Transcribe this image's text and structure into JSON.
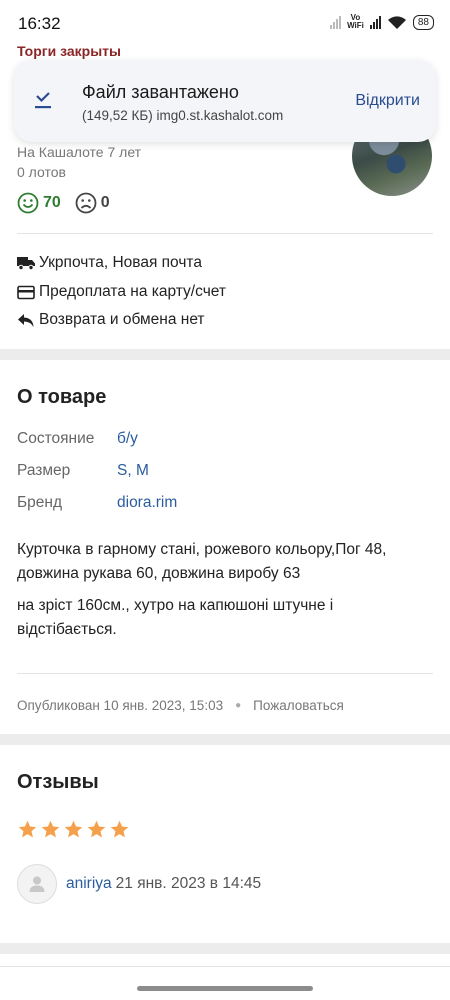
{
  "status_bar": {
    "time": "16:32",
    "network_label_top": "Vo",
    "network_label_bottom": "WiFi",
    "battery": "88"
  },
  "auction_status": "Торги закрыты",
  "download_toast": {
    "title": "Файл завантажено",
    "details": "(149,52 КБ) img0.st.kashalot.com",
    "open_label": "Відкрити"
  },
  "seller": {
    "member_since": "На Кашалоте 7 лет",
    "lots": "0 лотов",
    "positive_count": "70",
    "negative_count": "0"
  },
  "delivery": {
    "shipping": "Укрпочта, Новая почта",
    "payment": "Предоплата на карту/счет",
    "returns": "Возврата и обмена нет"
  },
  "product": {
    "heading": "О товаре",
    "properties": [
      {
        "label": "Состояние",
        "value": "б/у"
      },
      {
        "label": "Размер",
        "value": "S, M"
      },
      {
        "label": "Бренд",
        "value": "diora.rim"
      }
    ],
    "description": [
      "Курточка в гарному стані, рожевого кольору,Пог 48, довжина рукава 60, довжина виробу 63",
      "на зріст 160см., хутро на капюшоні штучне і відстібається."
    ],
    "published": "Опубликован 10 янв. 2023, 15:03",
    "report_label": "Пожаловаться"
  },
  "reviews": {
    "heading": "Отзывы",
    "rating": 5,
    "star_color": "#f5a04a",
    "items": [
      {
        "user": "aniriya",
        "date": "21 янв. 2023 в 14:45"
      }
    ]
  }
}
